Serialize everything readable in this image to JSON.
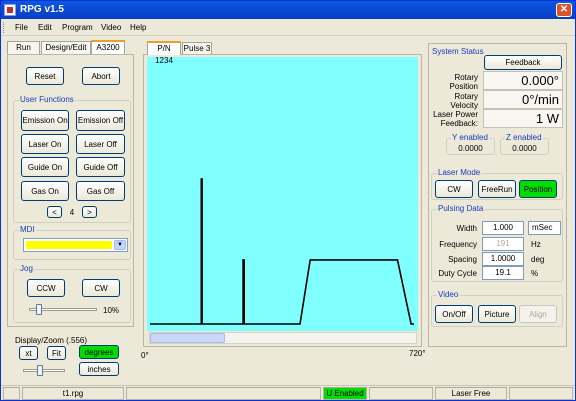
{
  "window": {
    "title": "RPG v1.5",
    "close_glyph": "✕"
  },
  "menu": {
    "items": [
      "File",
      "Edit",
      "Program",
      "Video",
      "Help"
    ]
  },
  "left_tabs": [
    "Run",
    "Design/Edit",
    "A3200"
  ],
  "controls": {
    "reset_label": "Reset",
    "abort_label": "Abort",
    "user_functions_title": "User Functions",
    "user_functions": [
      "Emission On",
      "Emission Off",
      "Laser On",
      "Laser Off",
      "Guide On",
      "Guide Off",
      "Gas On",
      "Gas Off"
    ],
    "page_prev": "<",
    "page_number": "4",
    "page_next": ">",
    "mdi_title": "MDI",
    "jog_title": "Jog",
    "ccw_label": "CCW",
    "cw_label": "CW",
    "jog_percent": "10%",
    "jog_level": 0.1
  },
  "display_zoom": {
    "title": "Display/Zoom (.556)",
    "xt_label": "xt",
    "fit_label": "Fit",
    "degrees_label": "degrees",
    "inches_label": "inches"
  },
  "plot": {
    "tabs": [
      "P/N 1234",
      "Pulse 3"
    ],
    "x_start_label": "0°",
    "x_end_label": "720°",
    "background": "#80ffff",
    "line_color": "#000000"
  },
  "chart_data": {
    "type": "line",
    "xlim": [
      0,
      720
    ],
    "x": [
      0,
      140,
      140,
      142,
      142,
      155,
      155,
      254,
      254,
      257,
      257,
      362,
      362,
      380,
      380,
      388,
      388,
      400,
      400,
      409,
      409,
      437,
      512,
      675,
      712,
      720
    ],
    "y": [
      0,
      0,
      0.95,
      0.95,
      0,
      0,
      0,
      0,
      0.42,
      0.42,
      0,
      0,
      0,
      0,
      0,
      0,
      0,
      0,
      0,
      0,
      0,
      0.42,
      0.42,
      0.42,
      0,
      0
    ]
  },
  "system_status": {
    "title": "System Status",
    "feedback_label": "Feedback",
    "rotary_position_label": "Rotary Position",
    "rotary_position_value": "0.000°",
    "rotary_velocity_label": "Rotary Velocity",
    "rotary_velocity_value": "0°/min",
    "laser_power_label": "Laser Power Feedback:",
    "laser_power_value": "1 W",
    "y_enabled_label": "Y enabled",
    "y_enabled_value": "0.0000",
    "z_enabled_label": "Z enabled",
    "z_enabled_value": "0.0000"
  },
  "laser_mode": {
    "title": "Laser Mode",
    "cw_label": "CW",
    "freerun_label": "FreeRun",
    "position_label": "Position",
    "active_color": "#00dd00"
  },
  "pulsing_data": {
    "title": "Pulsing Data",
    "rows": [
      {
        "label": "Width",
        "value": "1.000",
        "unit": "mSec"
      },
      {
        "label": "Frequency",
        "value": "191",
        "unit": "Hz"
      },
      {
        "label": "Spacing",
        "value": "1.0000",
        "unit": "deg"
      },
      {
        "label": "Duty Cycle",
        "value": "19.1",
        "unit": "%"
      }
    ]
  },
  "video": {
    "title": "Video",
    "onoff_label": "On/Off",
    "picture_label": "Picture",
    "align_label": "Align"
  },
  "status_bar": {
    "file_name": "t1.rpg",
    "u_enabled": "U Enabled",
    "laser_status": "Laser Free",
    "u_enabled_color": "#00dd00"
  }
}
